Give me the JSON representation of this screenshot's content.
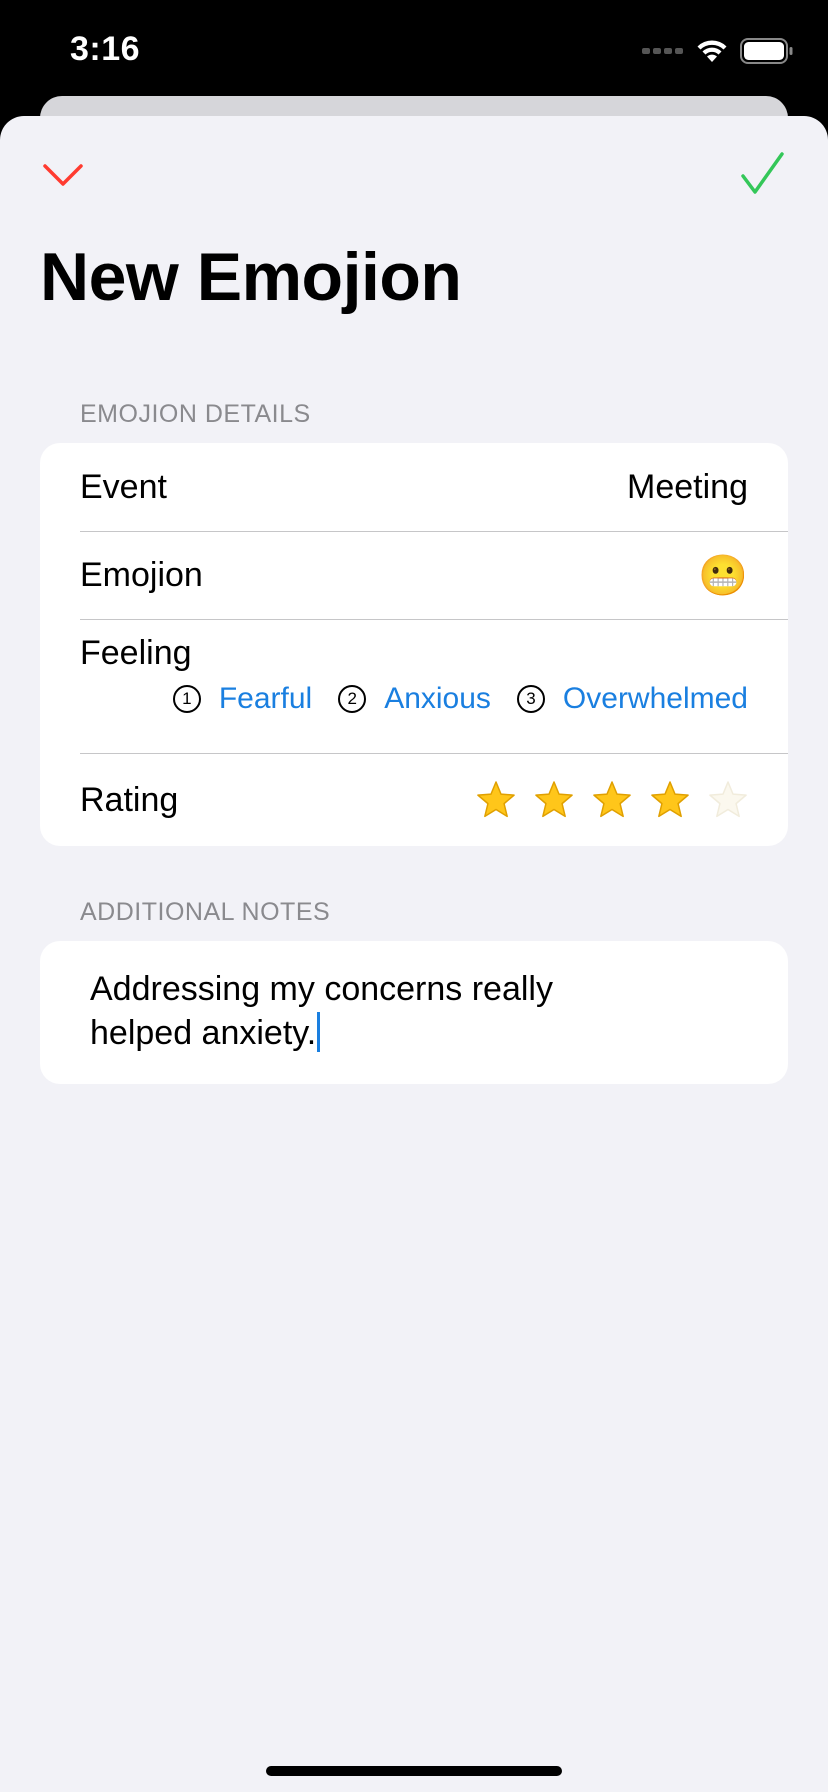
{
  "status_bar": {
    "time": "3:16"
  },
  "nav": {
    "cancel_icon": "chevron-down-icon",
    "done_icon": "checkmark-icon",
    "cancel_color": "#ff3b30",
    "done_color": "#34c759"
  },
  "title": "New Emojion",
  "details_section": {
    "header": "EMOJION DETAILS",
    "event": {
      "label": "Event",
      "value": "Meeting"
    },
    "emojion": {
      "label": "Emojion",
      "value": "😬"
    },
    "feeling": {
      "label": "Feeling",
      "options": [
        {
          "number": "1",
          "label": "Fearful"
        },
        {
          "number": "2",
          "label": "Anxious"
        },
        {
          "number": "3",
          "label": "Overwhelmed"
        }
      ]
    },
    "rating": {
      "label": "Rating",
      "value": 4,
      "max": 5
    }
  },
  "notes_section": {
    "header": "ADDITIONAL NOTES",
    "line1": "Addressing my concerns really",
    "line2": "helped anxiety."
  },
  "colors": {
    "accent": "#1a7fe0",
    "background": "#f2f2f7",
    "star": "#ffc61a"
  }
}
